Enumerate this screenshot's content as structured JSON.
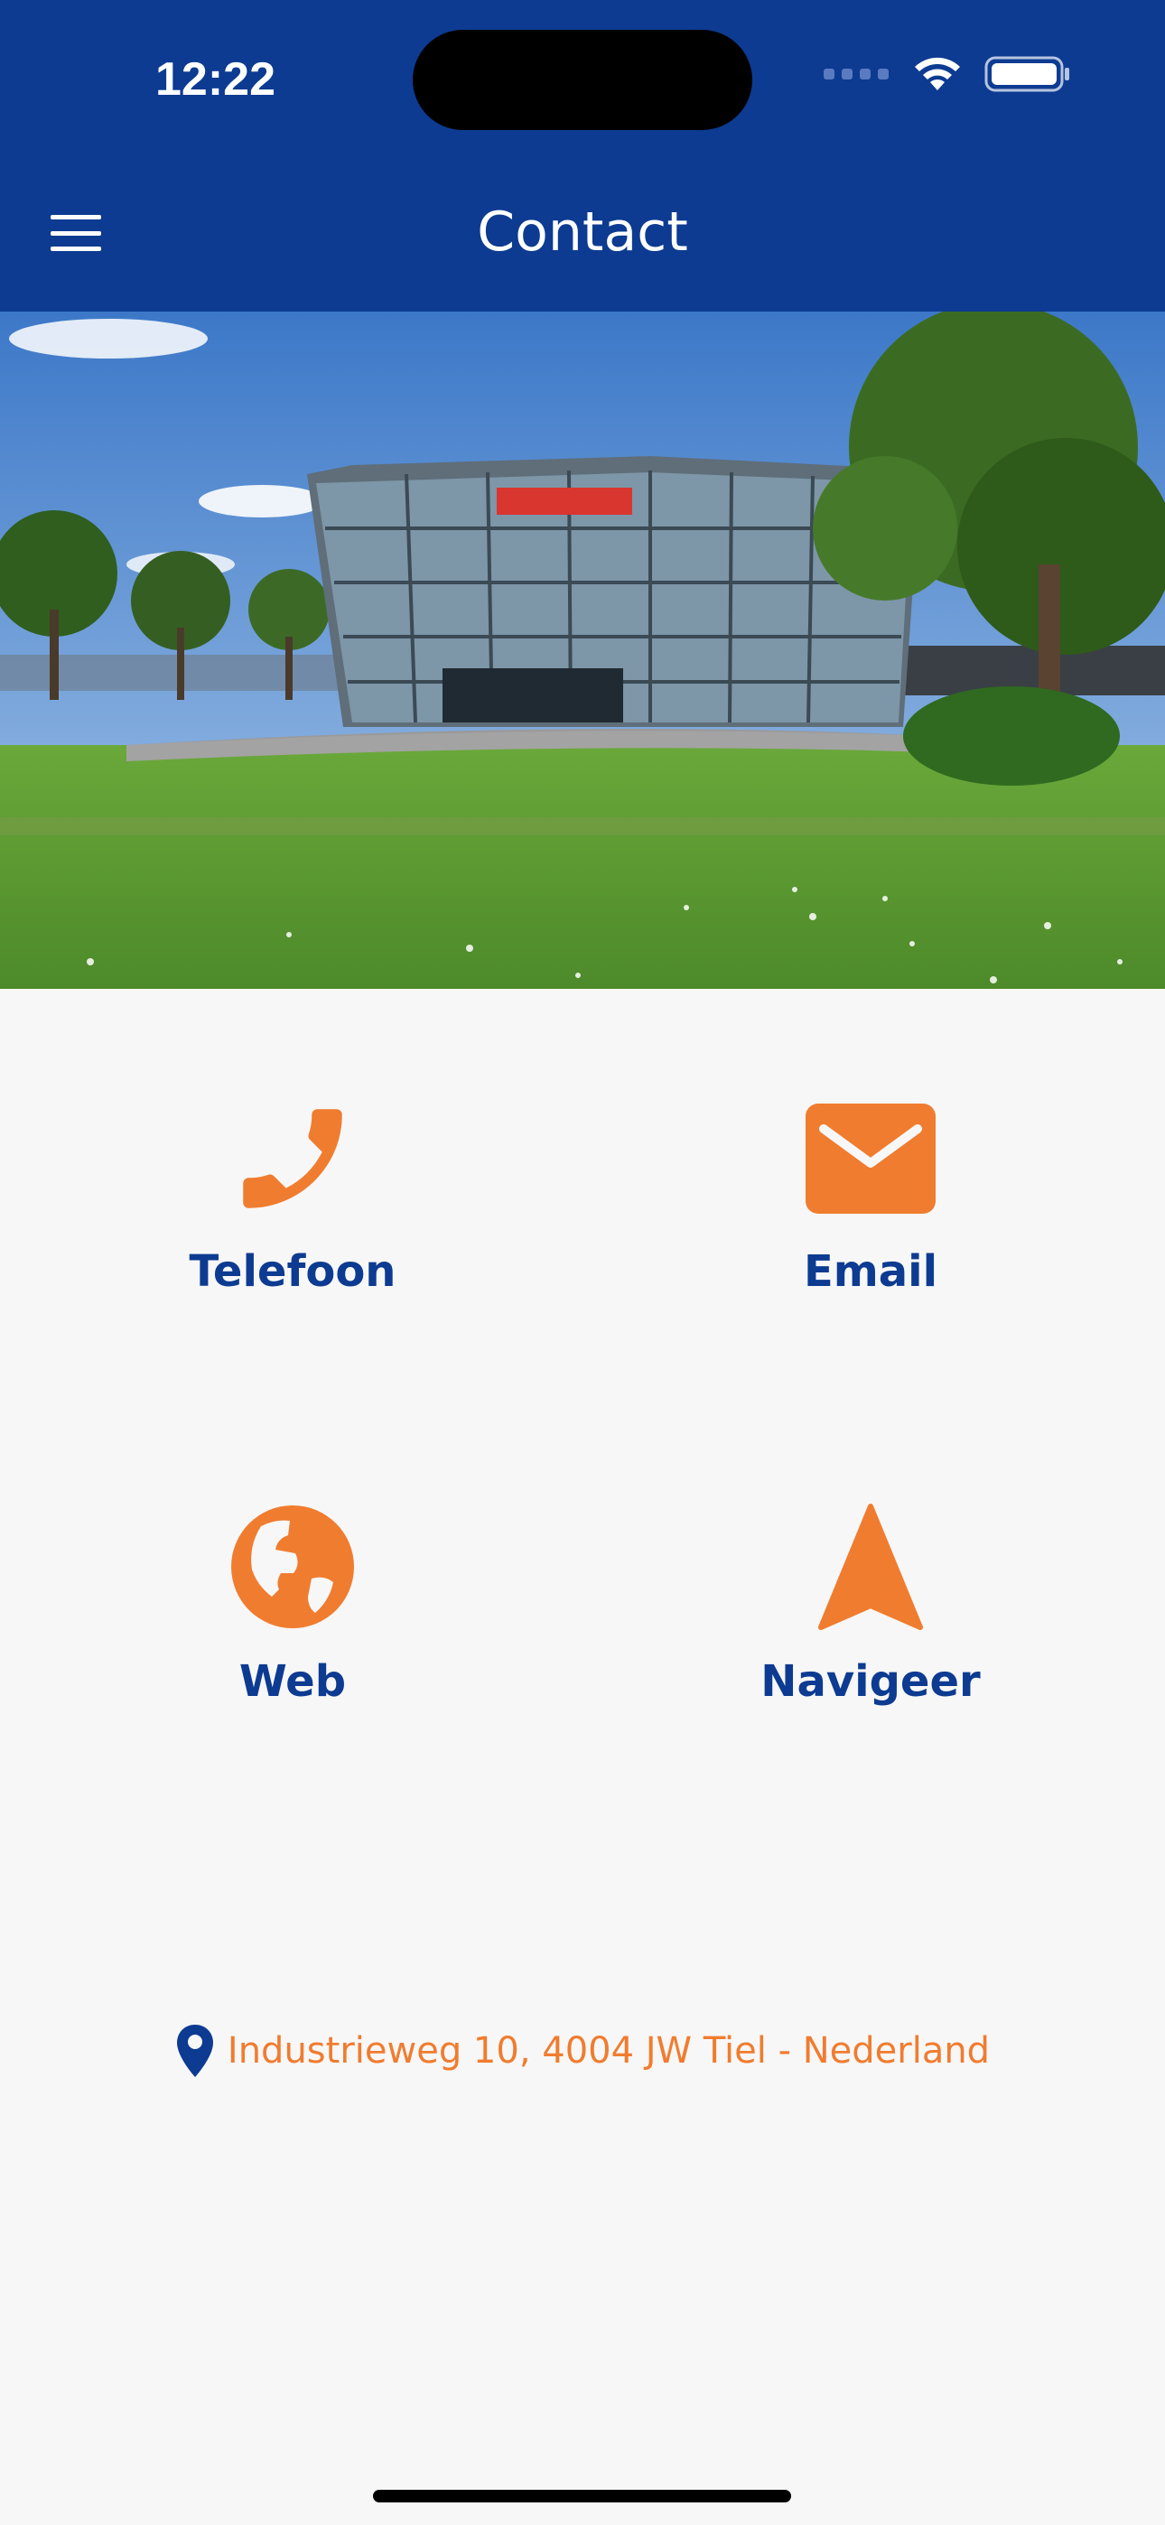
{
  "status_bar": {
    "time": "12:22"
  },
  "header": {
    "title": "Contact",
    "menu_icon": "hamburger-menu-icon"
  },
  "hero": {
    "alt": "building-photo"
  },
  "actions": [
    {
      "label": "Telefoon",
      "icon": "phone-icon"
    },
    {
      "label": "Email",
      "icon": "envelope-icon"
    },
    {
      "label": "Web",
      "icon": "globe-icon"
    },
    {
      "label": "Navigeer",
      "icon": "navigation-arrow-icon"
    }
  ],
  "address": {
    "text": "Industrieweg 10, 4004 JW Tiel - Nederland",
    "icon": "map-pin-icon"
  },
  "colors": {
    "primary": "#0d3b91",
    "accent": "#f07c2f",
    "background": "#f7f7f7"
  }
}
